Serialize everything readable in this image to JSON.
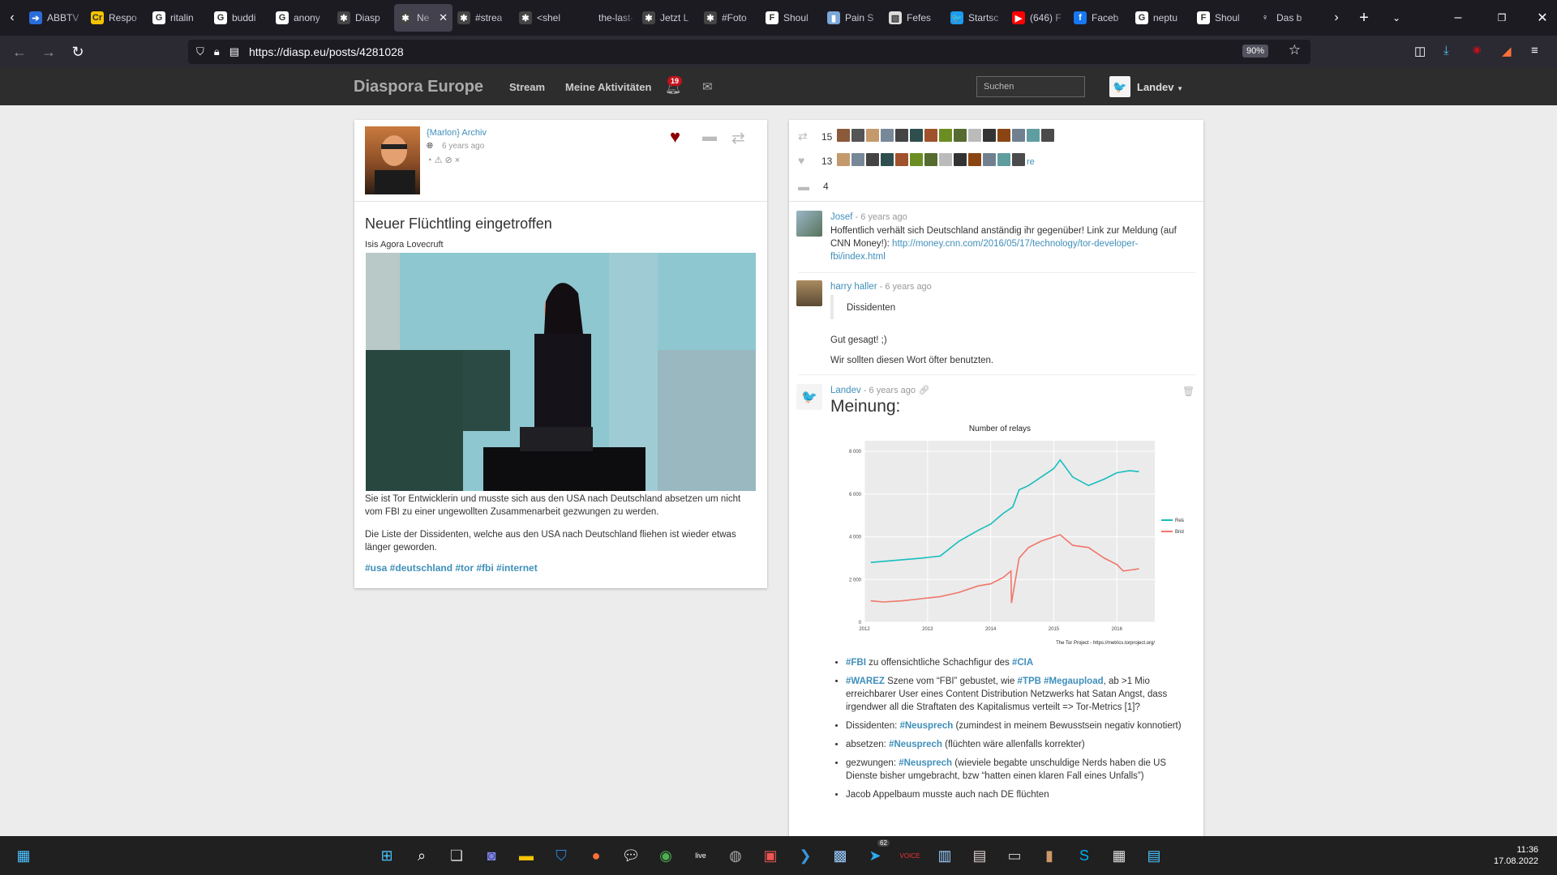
{
  "browser": {
    "tabs": [
      {
        "label": "ABBTV",
        "color": "#2a6dd9",
        "glyph": "➔"
      },
      {
        "label": "Respo",
        "color": "#f5c400",
        "glyph": "Cr"
      },
      {
        "label": "ritalin",
        "color": "#ffffff",
        "glyph": "G"
      },
      {
        "label": "buddi",
        "color": "#ffffff",
        "glyph": "G"
      },
      {
        "label": "anony",
        "color": "#ffffff",
        "glyph": "G"
      },
      {
        "label": "Diasp",
        "color": "#444444",
        "glyph": "✱"
      },
      {
        "label": "Ne",
        "color": "#444444",
        "glyph": "✱",
        "active": true
      },
      {
        "label": "#strea",
        "color": "#444444",
        "glyph": "✱"
      },
      {
        "label": "<shel",
        "color": "#444444",
        "glyph": "✱"
      },
      {
        "label": "the-last-o",
        "color": "#1c1b22",
        "glyph": ""
      },
      {
        "label": "Jetzt L",
        "color": "#444444",
        "glyph": "✱"
      },
      {
        "label": "#Foto",
        "color": "#444444",
        "glyph": "✱"
      },
      {
        "label": "Shoul",
        "color": "#ffffff",
        "glyph": "F"
      },
      {
        "label": "Pain S",
        "color": "#7aa7d6",
        "glyph": "▮"
      },
      {
        "label": "Fefes",
        "color": "#dddddd",
        "glyph": "▧"
      },
      {
        "label": "Startsc",
        "color": "#1d9bf0",
        "glyph": "🐦"
      },
      {
        "label": "(646) F",
        "color": "#ff0000",
        "glyph": "▶"
      },
      {
        "label": "Faceb",
        "color": "#1877f2",
        "glyph": "f"
      },
      {
        "label": "neptu",
        "color": "#ffffff",
        "glyph": "G"
      },
      {
        "label": "Shoul",
        "color": "#ffffff",
        "glyph": "F"
      },
      {
        "label": "Das b",
        "color": "#1c1b22",
        "glyph": "♀"
      }
    ],
    "url": "https://diasp.eu/posts/4281028",
    "zoom": "90%"
  },
  "site": {
    "brand": "Diaspora Europe",
    "nav_stream": "Stream",
    "nav_activity": "Meine Aktivitäten",
    "notif_count": "19",
    "search_placeholder": "Suchen",
    "user": "Landev"
  },
  "post": {
    "author": "{Marlon} Archiv",
    "time": "6 years ago",
    "title": "Neuer Flüchtling eingetroffen",
    "subtitle": "Isis Agora Lovecruft",
    "text1": "Sie ist Tor Entwicklerin und musste sich aus den USA nach Deutschland absetzen um nicht vom FBI zu einer ungewollten Zusammenarbeit gezwungen zu werden.",
    "text2": "Die Liste der Dissidenten, welche aus den USA nach Deutschland fliehen ist wieder etwas länger geworden.",
    "tags": "#usa #deutschland #tor #fbi #internet"
  },
  "interactions": {
    "reshares": "15",
    "likes": "13",
    "comments": "4",
    "like_overflow_text": "re"
  },
  "comments": [
    {
      "author": "Josef",
      "sep": " - ",
      "time": "6 years ago",
      "text": "Hoffentlich verhält sich Deutschland anständig ihr gegenüber! Link zur Meldung (auf CNN Money!): ",
      "link": "http://money.cnn.com/2016/05/17/technology/tor-developer-fbi/index.html"
    },
    {
      "author": "harry haller",
      "sep": " - ",
      "time": "6 years ago",
      "quote": "Dissidenten",
      "line1": "Gut gesagt! ;)",
      "line2": "Wir sollten diesen Wort öfter benutzten."
    },
    {
      "author": "Landev",
      "sep": " - ",
      "time": "6 years ago",
      "heading": "Meinung:",
      "bullets": [
        {
          "tag": "#FBI",
          "text": " zu offensichtliche Schachfigur des ",
          "tag2": "#CIA",
          "text2": ""
        },
        {
          "tag": "#WAREZ",
          "text": " Szene vom “FBI” gebustet, wie ",
          "tag2": "#TPB #Megaupload",
          "text2": ", ab >1 Mio erreichbarer User eines Content Distribution Netzwerks hat Satan Angst, dass irgendwer all die Straftaten des Kapitalismus verteilt => Tor-Metrics [1]?"
        },
        {
          "pre": "Dissidenten: ",
          "tag": "#Neusprech",
          "text": " (zumindest in meinem Bewusstsein negativ konnotiert)"
        },
        {
          "pre": "absetzen: ",
          "tag": "#Neusprech",
          "text": " (flüchten wäre allenfalls korrekter)"
        },
        {
          "pre": "gezwungen: ",
          "tag": "#Neusprech",
          "text": " (wieviele begabte unschuldige Nerds haben die US Dienste bisher umgebracht, bzw “hatten einen klaren Fall eines Unfalls”)"
        },
        {
          "pre": "Jacob Appelbaum musste auch nach DE flüchten",
          "tag": "",
          "text": ""
        }
      ]
    }
  ],
  "chart_data": {
    "type": "line",
    "title": "Number of relays",
    "x_ticks": [
      "2012",
      "2013",
      "2014",
      "2015",
      "2016"
    ],
    "y_ticks": [
      "0",
      "2 000",
      "4 000",
      "6 000",
      "8 000"
    ],
    "ylim": [
      0,
      8500
    ],
    "xlim": [
      2012.0,
      2016.6
    ],
    "caption": "The Tor Project - https://metrics.torproject.org/",
    "legend_position": "right",
    "grid": true,
    "series": [
      {
        "name": "Relays",
        "color": "#17bdbd",
        "x": [
          2012.1,
          2012.5,
          2012.9,
          2013.2,
          2013.5,
          2013.8,
          2014.0,
          2014.2,
          2014.35,
          2014.45,
          2014.6,
          2014.8,
          2015.0,
          2015.1,
          2015.3,
          2015.55,
          2015.8,
          2016.0,
          2016.2,
          2016.35
        ],
        "y": [
          2800,
          2900,
          3000,
          3100,
          3800,
          4300,
          4600,
          5100,
          5400,
          6200,
          6400,
          6800,
          7200,
          7600,
          6800,
          6400,
          6700,
          7000,
          7100,
          7050
        ]
      },
      {
        "name": "Bridges",
        "color": "#f0766b",
        "x": [
          2012.1,
          2012.3,
          2012.6,
          2012.9,
          2013.2,
          2013.5,
          2013.8,
          2014.0,
          2014.2,
          2014.32,
          2014.33,
          2014.45,
          2014.6,
          2014.8,
          2015.0,
          2015.1,
          2015.3,
          2015.55,
          2015.8,
          2016.0,
          2016.1,
          2016.35
        ],
        "y": [
          1000,
          950,
          1000,
          1100,
          1200,
          1400,
          1700,
          1800,
          2100,
          2400,
          900,
          3000,
          3500,
          3800,
          4000,
          4100,
          3600,
          3500,
          3000,
          2700,
          2400,
          2500
        ]
      }
    ]
  },
  "taskbar": {
    "telegram_badge": "62",
    "time": "11:36",
    "date": "17.08.2022"
  }
}
